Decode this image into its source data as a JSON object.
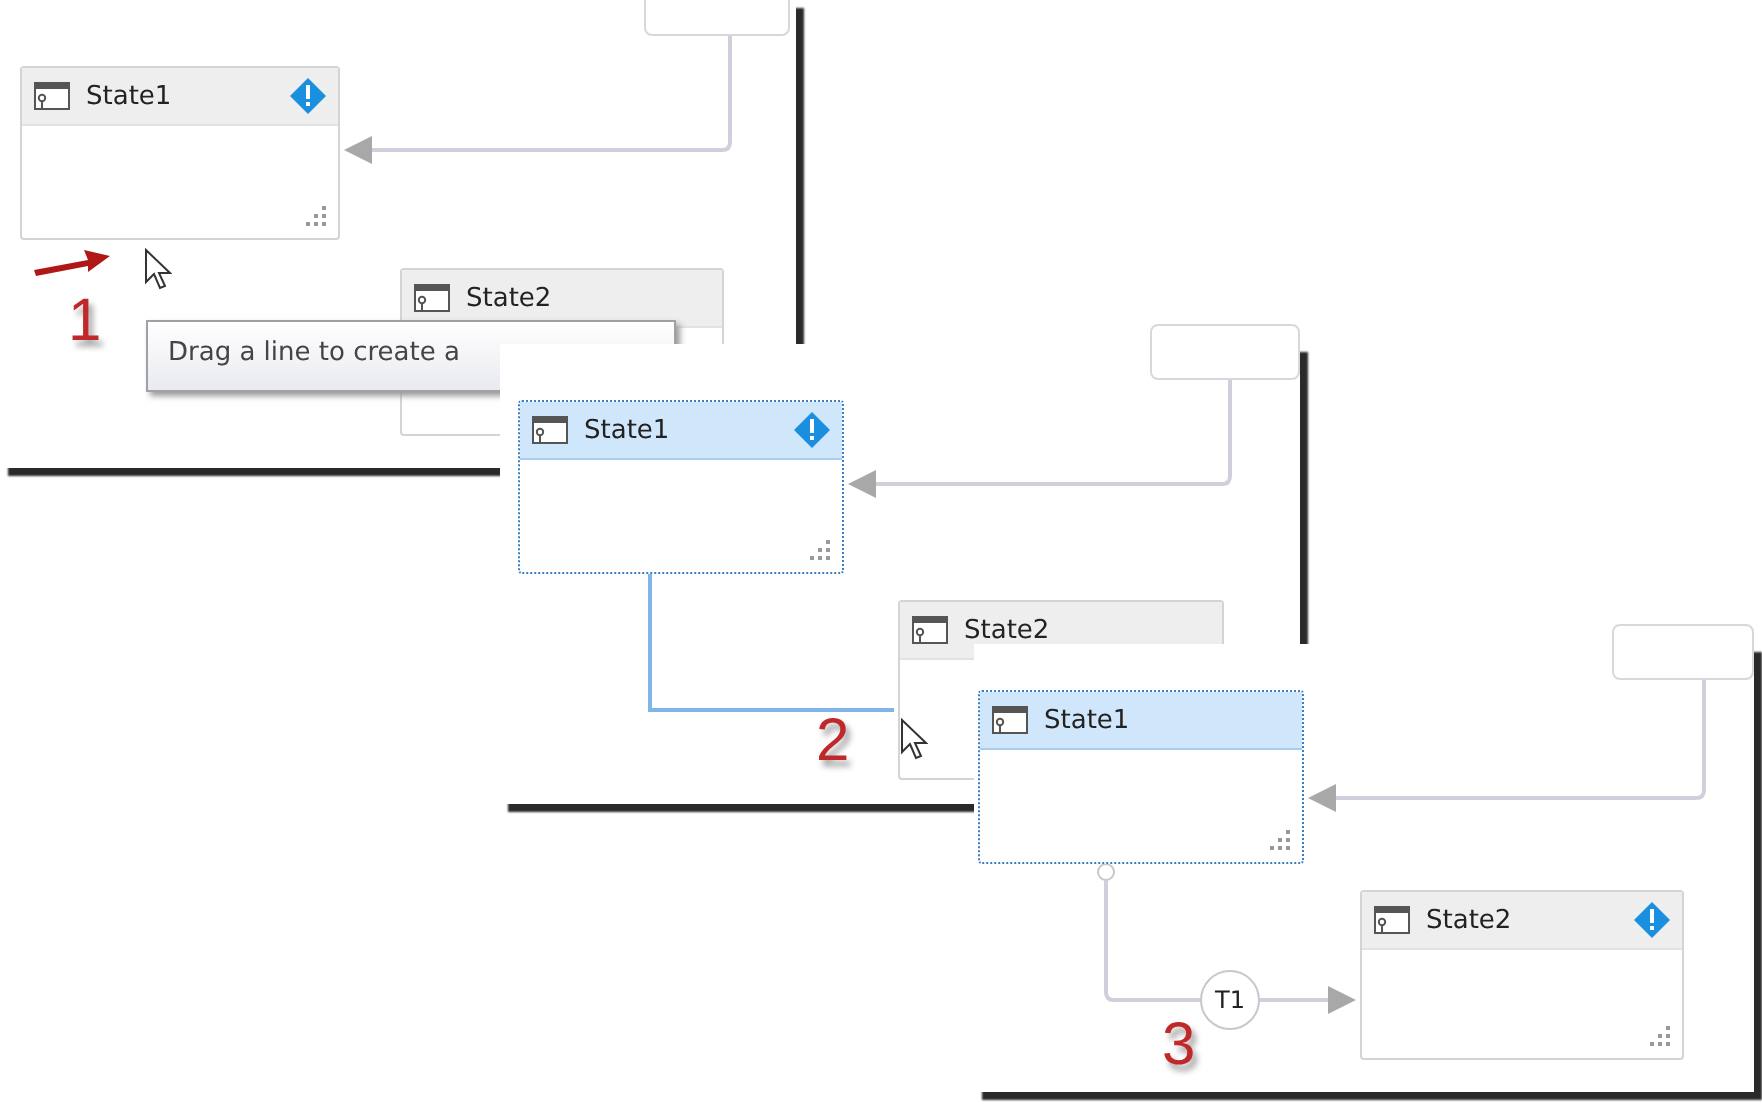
{
  "panels": [
    {
      "step": "1",
      "pointer_arrow": true,
      "tooltip": "Drag a line to create a",
      "states": [
        {
          "name": "State1",
          "selected": false,
          "warning": true
        },
        {
          "name": "State2",
          "selected": false,
          "warning": false
        }
      ]
    },
    {
      "step": "2",
      "drag_line": true,
      "states": [
        {
          "name": "State1",
          "selected": true,
          "warning": true
        },
        {
          "name": "State2",
          "selected": false,
          "warning": false
        }
      ]
    },
    {
      "step": "3",
      "transitions": [
        {
          "label": "T1"
        }
      ],
      "states": [
        {
          "name": "State1",
          "selected": true,
          "warning": false
        },
        {
          "name": "State2",
          "selected": false,
          "warning": true
        }
      ]
    }
  ]
}
